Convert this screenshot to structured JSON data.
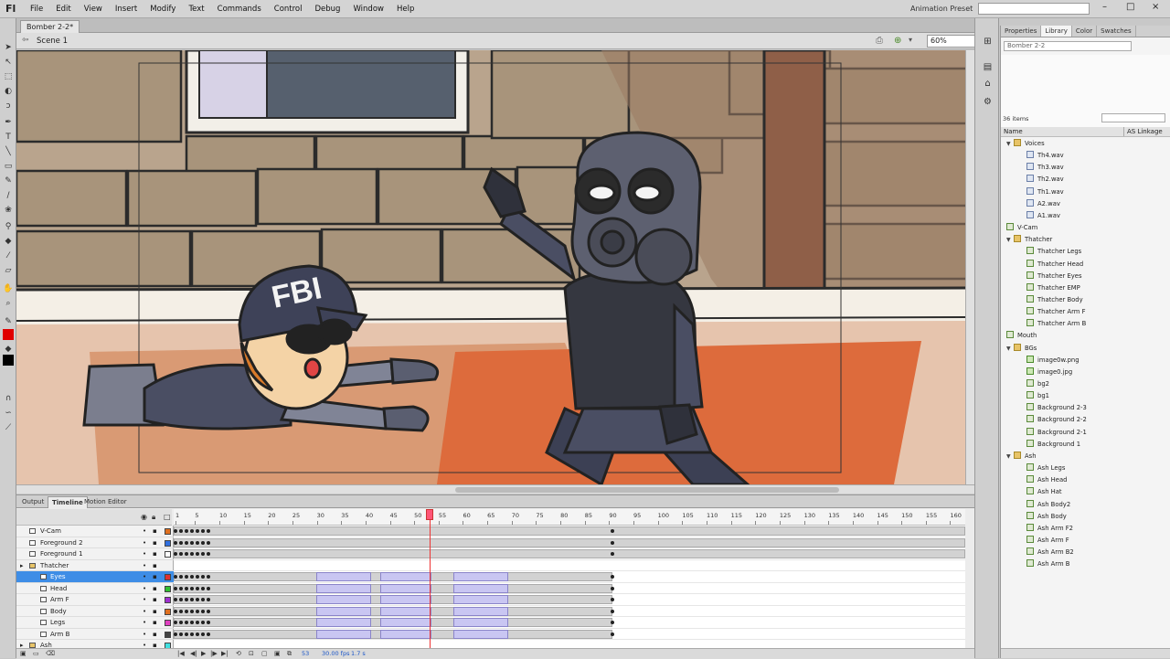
{
  "app": {
    "logo": "Fl",
    "menu": [
      "File",
      "Edit",
      "View",
      "Insert",
      "Modify",
      "Text",
      "Commands",
      "Control",
      "Debug",
      "Window",
      "Help"
    ],
    "preset_label": "Animation Preset",
    "window_buttons": [
      "–",
      "□",
      "×"
    ]
  },
  "document": {
    "tab": "Bomber 2-2*",
    "scene": "Scene 1",
    "zoom": "60%"
  },
  "panels": {
    "tabs": [
      "Properties",
      "Library",
      "Color",
      "Swatches"
    ],
    "active_tab": "Library",
    "library_doc": "Bomber 2-2",
    "item_count": "36 items",
    "col_name": "Name",
    "col_linkage": "AS Linkage",
    "items": [
      {
        "label": "Voices",
        "type": "folder",
        "level": 0
      },
      {
        "label": "Th4.wav",
        "type": "sound",
        "level": 1
      },
      {
        "label": "Th3.wav",
        "type": "sound",
        "level": 1
      },
      {
        "label": "Th2.wav",
        "type": "sound",
        "level": 1
      },
      {
        "label": "Th1.wav",
        "type": "sound",
        "level": 1
      },
      {
        "label": "A2.wav",
        "type": "sound",
        "level": 1
      },
      {
        "label": "A1.wav",
        "type": "sound",
        "level": 1
      },
      {
        "label": "V-Cam",
        "type": "sym",
        "level": 0
      },
      {
        "label": "Thatcher",
        "type": "folder",
        "level": 0
      },
      {
        "label": "Thatcher Legs",
        "type": "sym",
        "level": 1
      },
      {
        "label": "Thatcher Head",
        "type": "sym",
        "level": 1
      },
      {
        "label": "Thatcher Eyes",
        "type": "sym",
        "level": 1
      },
      {
        "label": "Thatcher EMP",
        "type": "sym",
        "level": 1
      },
      {
        "label": "Thatcher Body",
        "type": "sym",
        "level": 1
      },
      {
        "label": "Thatcher Arm F",
        "type": "sym",
        "level": 1
      },
      {
        "label": "Thatcher Arm B",
        "type": "sym",
        "level": 1
      },
      {
        "label": "Mouth",
        "type": "sym",
        "level": 0
      },
      {
        "label": "BGs",
        "type": "folder",
        "level": 0
      },
      {
        "label": "image0w.png",
        "type": "img",
        "level": 1
      },
      {
        "label": "image0.jpg",
        "type": "img",
        "level": 1
      },
      {
        "label": "bg2",
        "type": "sym",
        "level": 1
      },
      {
        "label": "bg1",
        "type": "sym",
        "level": 1
      },
      {
        "label": "Background 2-3",
        "type": "sym",
        "level": 1
      },
      {
        "label": "Background 2-2",
        "type": "sym",
        "level": 1
      },
      {
        "label": "Background 2-1",
        "type": "sym",
        "level": 1
      },
      {
        "label": "Background 1",
        "type": "sym",
        "level": 1
      },
      {
        "label": "Ash",
        "type": "folder",
        "level": 0
      },
      {
        "label": "Ash Legs",
        "type": "sym",
        "level": 1
      },
      {
        "label": "Ash Head",
        "type": "sym",
        "level": 1
      },
      {
        "label": "Ash Hat",
        "type": "sym",
        "level": 1
      },
      {
        "label": "Ash Body2",
        "type": "sym",
        "level": 1
      },
      {
        "label": "Ash Body",
        "type": "sym",
        "level": 1
      },
      {
        "label": "Ash Arm F2",
        "type": "sym",
        "level": 1
      },
      {
        "label": "Ash Arm F",
        "type": "sym",
        "level": 1
      },
      {
        "label": "Ash Arm B2",
        "type": "sym",
        "level": 1
      },
      {
        "label": "Ash Arm B",
        "type": "sym",
        "level": 1
      }
    ]
  },
  "stage": {
    "cap_text": "FBI"
  },
  "timeline": {
    "tabs": [
      "Output",
      "Timeline",
      "Motion Editor"
    ],
    "active_tab": "Timeline",
    "ruler": [
      1,
      5,
      10,
      15,
      20,
      25,
      30,
      35,
      40,
      45,
      50,
      55,
      60,
      65,
      70,
      75,
      80,
      85,
      90,
      95,
      100,
      105,
      110,
      115,
      120,
      125,
      130,
      135,
      140,
      145,
      150,
      155,
      160
    ],
    "current_frame": "53",
    "fps": "30.00 fps",
    "elapsed": "1.7 s",
    "layers": [
      {
        "name": "V-Cam",
        "type": "layer",
        "level": 0,
        "color": "#e07020",
        "selected": false
      },
      {
        "name": "Foreground 2",
        "type": "layer",
        "level": 0,
        "color": "#3070e0",
        "selected": false
      },
      {
        "name": "Foreground 1",
        "type": "layer",
        "level": 0,
        "color": "#ffffff",
        "selected": false
      },
      {
        "name": "Thatcher",
        "type": "folder",
        "level": 0,
        "color": "",
        "selected": false
      },
      {
        "name": "Eyes",
        "type": "layer",
        "level": 1,
        "color": "#e03030",
        "selected": true
      },
      {
        "name": "Head",
        "type": "layer",
        "level": 1,
        "color": "#30c030",
        "selected": false
      },
      {
        "name": "Arm F",
        "type": "layer",
        "level": 1,
        "color": "#a030d0",
        "selected": false
      },
      {
        "name": "Body",
        "type": "layer",
        "level": 1,
        "color": "#e07020",
        "selected": false
      },
      {
        "name": "Legs",
        "type": "layer",
        "level": 1,
        "color": "#e040c0",
        "selected": false
      },
      {
        "name": "Arm B",
        "type": "layer",
        "level": 1,
        "color": "#444444",
        "selected": false
      },
      {
        "name": "Ash",
        "type": "folder",
        "level": 0,
        "color": "#40e0e0",
        "selected": false
      }
    ]
  }
}
